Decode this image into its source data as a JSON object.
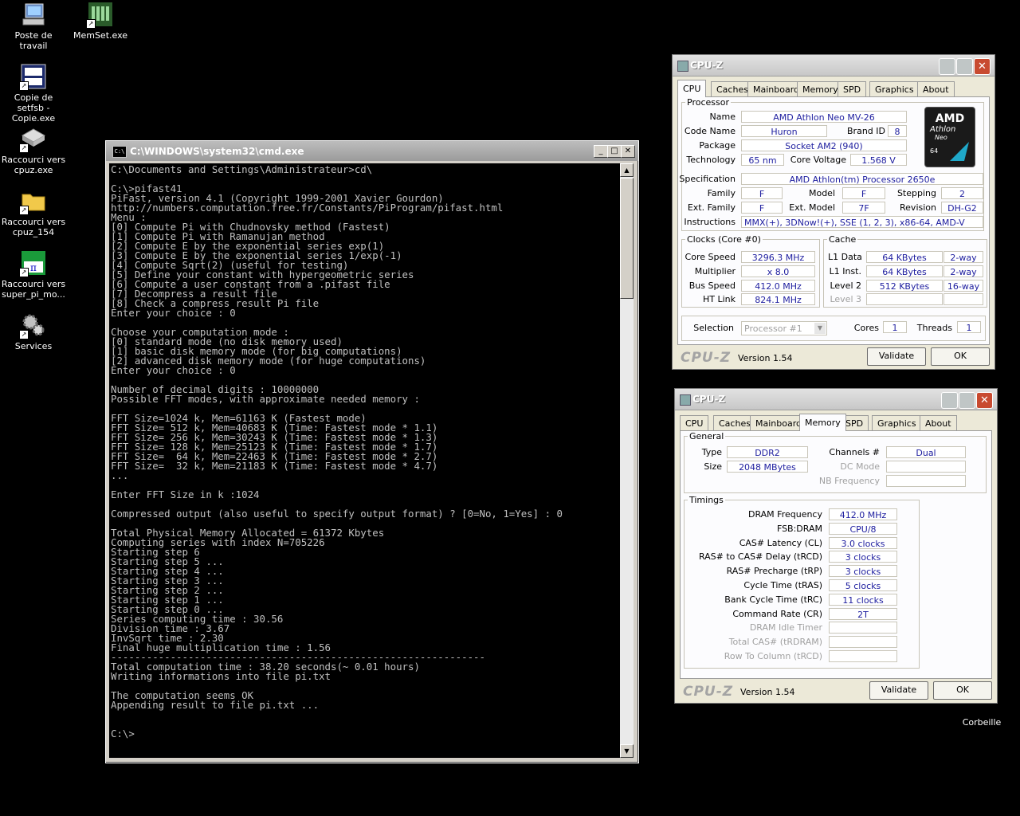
{
  "desktop": {
    "icons": [
      {
        "label": "Poste de travail"
      },
      {
        "label": "MemSet.exe"
      },
      {
        "label": "Copie de setfsb - Copie.exe"
      },
      {
        "label": "Raccourci vers cpuz.exe"
      },
      {
        "label": "Raccourci vers cpuz_154"
      },
      {
        "label": "Raccourci vers super_pi_mo..."
      },
      {
        "label": "Services"
      },
      {
        "label": "Corbeille"
      }
    ]
  },
  "cmd": {
    "title": "C:\\WINDOWS\\system32\\cmd.exe",
    "icon_text": "C:\\",
    "output": "C:\\Documents and Settings\\Administrateur>cd\\\n\nC:\\>pifast41\nPiFast, version 4.1 (Copyright 1999-2001 Xavier Gourdon)\nhttp://numbers.computation.free.fr/Constants/PiProgram/pifast.html\nMenu :\n[0] Compute Pi with Chudnovsky method (Fastest)\n[1] Compute Pi with Ramanujan method\n[2] Compute E by the exponential series exp(1)\n[3] Compute E by the exponential series 1/exp(-1)\n[4] Compute Sqrt(2) (useful for testing)\n[5] Define your constant with hypergeometric series\n[6] Compute a user constant from a .pifast file\n[7] Decompress a result file\n[8] Check a compress result Pi file\nEnter your choice : 0\n\nChoose your computation mode :\n[0] standard mode (no disk memory used)\n[1] basic disk memory mode (for big computations)\n[2] advanced disk memory mode (for huge computations)\nEnter your choice : 0\n\nNumber of decimal digits : 10000000\nPossible FFT modes, with approximate needed memory :\n\nFFT Size=1024 k, Mem=61163 K (Fastest mode)\nFFT Size= 512 k, Mem=40683 K (Time: Fastest mode * 1.1)\nFFT Size= 256 k, Mem=30243 K (Time: Fastest mode * 1.3)\nFFT Size= 128 k, Mem=25123 K (Time: Fastest mode * 1.7)\nFFT Size=  64 k, Mem=22463 K (Time: Fastest mode * 2.7)\nFFT Size=  32 k, Mem=21183 K (Time: Fastest mode * 4.7)\n...\n\nEnter FFT Size in k :1024\n\nCompressed output (also useful to specify output format) ? [0=No, 1=Yes] : 0\n\nTotal Physical Memory Allocated = 61372 Kbytes\nComputing series with index N=705226\nStarting step 6\nStarting step 5 ...\nStarting step 4 ...\nStarting step 3 ...\nStarting step 2 ...\nStarting step 1 ...\nStarting step 0 ...\nSeries computing time : 30.56\nDivision time : 3.67\nInvSqrt time : 2.30\nFinal huge multiplication time : 1.56\n---------------------------------------------------------------\nTotal computation time : 38.20 seconds(~ 0.01 hours)\nWriting informations into file pi.txt\n\nThe computation seems OK\nAppending result to file pi.txt ...\n\n\nC:\\>"
  },
  "cpuz_cpu": {
    "title": "CPU-Z",
    "tabs": [
      "CPU",
      "Caches",
      "Mainboard",
      "Memory",
      "SPD",
      "Graphics",
      "About"
    ],
    "active_tab": "CPU",
    "processor_legend": "Processor",
    "name_label": "Name",
    "name": "AMD Athlon Neo MV-26",
    "codename_label": "Code Name",
    "codename": "Huron",
    "brandid_label": "Brand ID",
    "brandid": "8",
    "package_label": "Package",
    "package": "Socket AM2 (940)",
    "technology_label": "Technology",
    "technology": "65 nm",
    "corevoltage_label": "Core Voltage",
    "corevoltage": "1.568 V",
    "spec_label": "Specification",
    "spec": "AMD Athlon(tm) Processor 2650e",
    "family_label": "Family",
    "family": "F",
    "model_label": "Model",
    "model": "F",
    "stepping_label": "Stepping",
    "stepping": "2",
    "extfamily_label": "Ext. Family",
    "extfamily": "F",
    "extmodel_label": "Ext. Model",
    "extmodel": "7F",
    "revision_label": "Revision",
    "revision": "DH-G2",
    "instructions_label": "Instructions",
    "instructions": "MMX(+), 3DNow!(+), SSE (1, 2, 3), x86-64, AMD-V",
    "logo_brand": "AMD",
    "logo_line1": "Athlon",
    "logo_line2": "Neo",
    "logo_line3": "64",
    "clocks_legend": "Clocks (Core #0)",
    "corespeed_label": "Core Speed",
    "corespeed": "3296.3 MHz",
    "multiplier_label": "Multiplier",
    "multiplier": "x 8.0",
    "busspeed_label": "Bus Speed",
    "busspeed": "412.0 MHz",
    "htlink_label": "HT Link",
    "htlink": "824.1 MHz",
    "cache_legend": "Cache",
    "l1data_label": "L1 Data",
    "l1data": "64 KBytes",
    "l1data_way": "2-way",
    "l1inst_label": "L1 Inst.",
    "l1inst": "64 KBytes",
    "l1inst_way": "2-way",
    "level2_label": "Level 2",
    "level2": "512 KBytes",
    "level2_way": "16-way",
    "level3_label": "Level 3",
    "selection_label": "Selection",
    "selection": "Processor #1",
    "cores_label": "Cores",
    "cores": "1",
    "threads_label": "Threads",
    "threads": "1",
    "brand": "CPU-Z",
    "version": "Version 1.54",
    "validate": "Validate",
    "ok": "OK"
  },
  "cpuz_mem": {
    "title": "CPU-Z",
    "tabs": [
      "CPU",
      "Caches",
      "Mainboard",
      "Memory",
      "SPD",
      "Graphics",
      "About"
    ],
    "active_tab": "Memory",
    "general_legend": "General",
    "type_label": "Type",
    "type": "DDR2",
    "size_label": "Size",
    "size": "2048 MBytes",
    "channels_label": "Channels #",
    "channels": "Dual",
    "dcmode_label": "DC Mode",
    "nbfreq_label": "NB Frequency",
    "timings_legend": "Timings",
    "timings": [
      {
        "label": "DRAM Frequency",
        "value": "412.0 MHz",
        "dim": false
      },
      {
        "label": "FSB:DRAM",
        "value": "CPU/8",
        "dim": false
      },
      {
        "label": "CAS# Latency (CL)",
        "value": "3.0 clocks",
        "dim": false
      },
      {
        "label": "RAS# to CAS# Delay (tRCD)",
        "value": "3 clocks",
        "dim": false
      },
      {
        "label": "RAS# Precharge (tRP)",
        "value": "3 clocks",
        "dim": false
      },
      {
        "label": "Cycle Time (tRAS)",
        "value": "5 clocks",
        "dim": false
      },
      {
        "label": "Bank Cycle Time (tRC)",
        "value": "11 clocks",
        "dim": false
      },
      {
        "label": "Command Rate (CR)",
        "value": "2T",
        "dim": false
      },
      {
        "label": "DRAM Idle Timer",
        "value": "",
        "dim": true
      },
      {
        "label": "Total CAS# (tRDRAM)",
        "value": "",
        "dim": true
      },
      {
        "label": "Row To Column (tRCD)",
        "value": "",
        "dim": true
      }
    ],
    "brand": "CPU-Z",
    "version": "Version 1.54",
    "validate": "Validate",
    "ok": "OK"
  }
}
